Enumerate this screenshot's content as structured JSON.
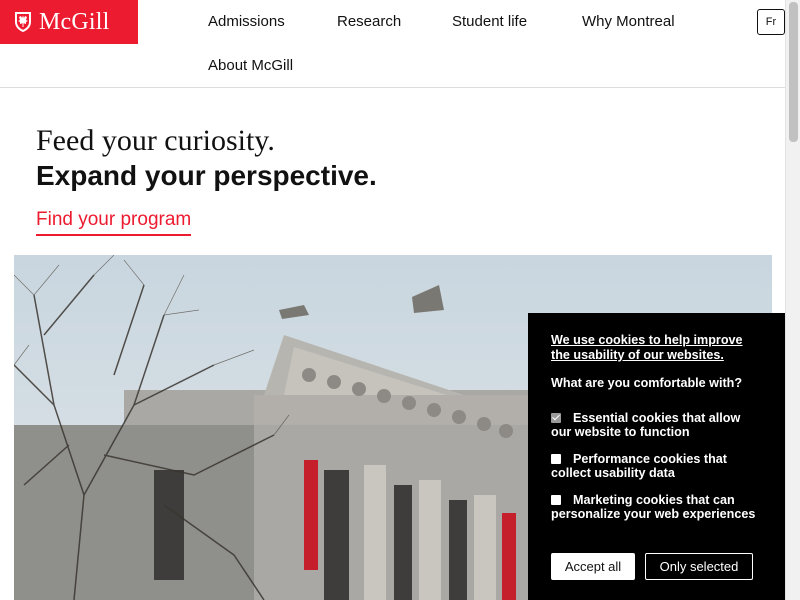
{
  "header": {
    "logo_text": "McGill",
    "nav": [
      "Admissions",
      "Research",
      "Student life",
      "Why Montreal",
      "About McGill"
    ],
    "lang_toggle": "Fr"
  },
  "hero": {
    "line1": "Feed your curiosity.",
    "line2": "Expand your perspective.",
    "cta": "Find your program"
  },
  "cookie_banner": {
    "intro": "We use cookies to help improve the usability of our websites.",
    "question": "What are you comfortable with?",
    "options": [
      {
        "label": "Essential cookies that allow our website to function",
        "checked": true,
        "disabled": true
      },
      {
        "label": "Performance cookies that collect usability data",
        "checked": false
      },
      {
        "label": "Marketing cookies that can personalize your web experiences",
        "checked": false
      }
    ],
    "accept_all": "Accept all",
    "only_selected": "Only selected"
  },
  "colors": {
    "brand_red": "#ed1b2f",
    "banner_bg": "#000000"
  },
  "icons": [
    "mcgill-crest-icon"
  ]
}
